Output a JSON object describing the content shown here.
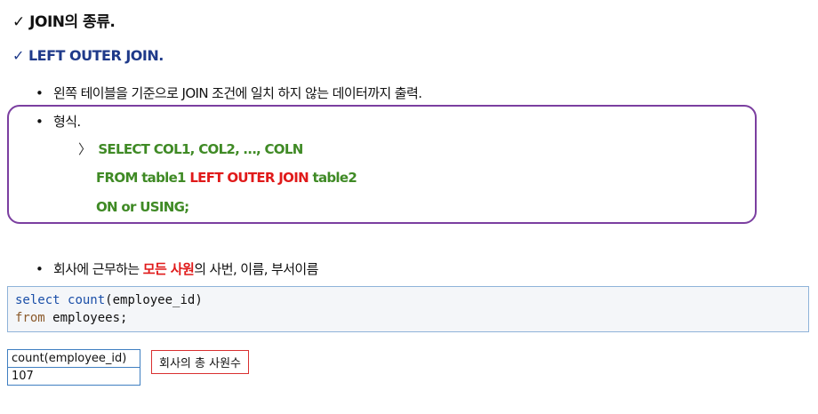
{
  "heading": "✓ JOIN의 종류.",
  "subheading": "✓ LEFT OUTER JOIN.",
  "bullet_char": "•",
  "description": "왼쪽 테이블을 기준으로 JOIN 조건에 일치 하지 않는 데이터까지 출력.",
  "syntax": {
    "label": "형식.",
    "arrow": "〉",
    "line1": "SELECT COL1, COL2, …, COLN",
    "line2_pre": "FROM table1 ",
    "line2_kw": "LEFT OUTER JOIN",
    "line2_post": " table2",
    "line3": "ON or USING;"
  },
  "example": {
    "pre": "회사에 근무하는 ",
    "highlight": "모든 사원",
    "post": "의 사번, 이름, 부서이름"
  },
  "code": {
    "kw_select": "select",
    "fn_count": "count",
    "arg": "(employee_id)",
    "kw_from": "from",
    "table": " employees;"
  },
  "result": {
    "column": "count(employee_id)",
    "value": "107"
  },
  "note": "회사의 총 사원수",
  "colors": {
    "accent_blue": "#1f3a8a",
    "sql_green": "#3f8a25",
    "keyword_red": "#e01a1a",
    "box_purple": "#7b3fa0"
  }
}
